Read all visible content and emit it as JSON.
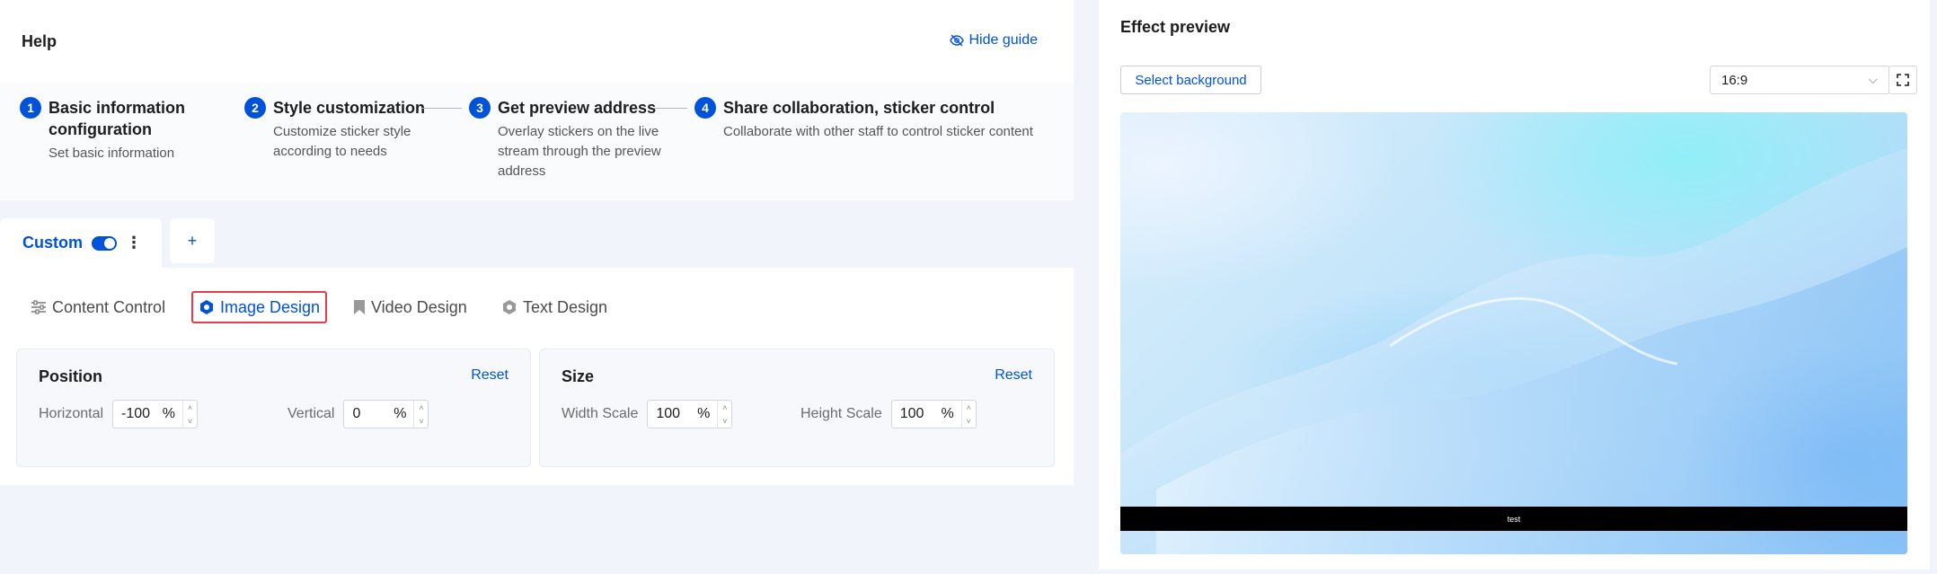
{
  "help": {
    "title": "Help",
    "hide_guide": "Hide guide"
  },
  "steps": [
    {
      "num": "1",
      "title_line1": "Basic information",
      "title_line2": "configuration",
      "desc_line1": "Set basic information",
      "desc_line2": "",
      "desc_line3": ""
    },
    {
      "num": "2",
      "title_line1": "Style customization",
      "title_line2": "",
      "desc_line1": "Customize sticker style",
      "desc_line2": "according to needs",
      "desc_line3": ""
    },
    {
      "num": "3",
      "title_line1": "Get preview address",
      "title_line2": "",
      "desc_line1": "Overlay stickers on the live",
      "desc_line2": "stream through the preview",
      "desc_line3": "address"
    },
    {
      "num": "4",
      "title_line1": "Share collaboration, sticker control",
      "title_line2": "",
      "desc_line1": "Collaborate with other staff to control sticker content",
      "desc_line2": "",
      "desc_line3": ""
    }
  ],
  "custom_tab": {
    "label": "Custom",
    "enabled": true,
    "add_label": "+"
  },
  "design_tabs": [
    {
      "label": "Content Control",
      "icon": "sliders-icon",
      "active": false
    },
    {
      "label": "Image Design",
      "icon": "hexagon-icon",
      "active": true
    },
    {
      "label": "Video Design",
      "icon": "bookmark-icon",
      "active": false
    },
    {
      "label": "Text Design",
      "icon": "gear-hexagon-icon",
      "active": false
    }
  ],
  "position": {
    "title": "Position",
    "reset": "Reset",
    "horizontal": {
      "label": "Horizontal",
      "value": "-100",
      "unit": "%"
    },
    "vertical": {
      "label": "Vertical",
      "value": "0",
      "unit": "%"
    }
  },
  "size": {
    "title": "Size",
    "reset": "Reset",
    "width": {
      "label": "Width Scale",
      "value": "100",
      "unit": "%"
    },
    "height": {
      "label": "Height Scale",
      "value": "100",
      "unit": "%"
    }
  },
  "preview": {
    "title": "Effect preview",
    "select_background": "Select background",
    "ratio": "16:9",
    "overlay_text": "test"
  },
  "colors": {
    "accent": "#0052d9",
    "active_outline": "#e53e46"
  }
}
